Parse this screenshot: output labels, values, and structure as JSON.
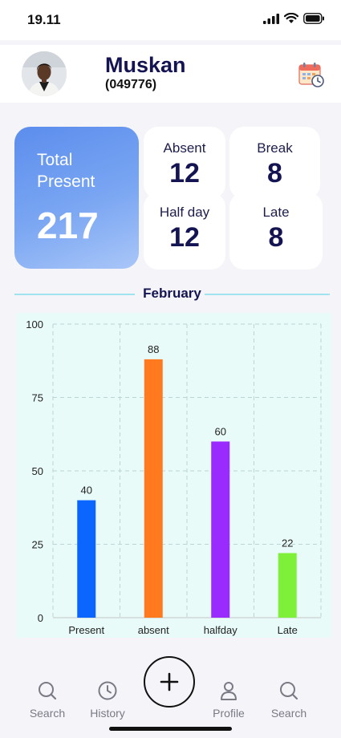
{
  "status_bar": {
    "time": "19.11",
    "icons": [
      "signal-icon",
      "wifi-icon",
      "battery-icon"
    ]
  },
  "header": {
    "name": "Muskan",
    "employee_id": "(049776)",
    "avatar_icon": "user-avatar",
    "calendar_icon": "calendar-clock-icon"
  },
  "stats": {
    "total_present": {
      "label": "Total Present",
      "value": "217"
    },
    "absent": {
      "label": "Absent",
      "value": "12"
    },
    "break": {
      "label": "Break",
      "value": "8"
    },
    "half_day": {
      "label": "Half day",
      "value": "12"
    },
    "late": {
      "label": "Late",
      "value": "8"
    }
  },
  "month": "February",
  "colors": {
    "accent": "#5b8ded",
    "chart_bg": "#e8fbf8",
    "present": "#0b66ff",
    "absent": "#ff7a1f",
    "halfday": "#9a2bff",
    "late": "#7ff03a"
  },
  "chart_data": {
    "type": "bar",
    "categories": [
      "Present",
      "absent",
      "halfday",
      "Late"
    ],
    "values": [
      40,
      88,
      60,
      22
    ],
    "ylim": [
      0,
      100
    ],
    "yticks": [
      0,
      25,
      50,
      75,
      100
    ],
    "grid": true,
    "bar_colors": [
      "#0b66ff",
      "#ff7a1f",
      "#9a2bff",
      "#7ff03a"
    ],
    "data_labels": true
  },
  "nav": {
    "items": [
      {
        "label": "Search",
        "icon": "search-icon"
      },
      {
        "label": "History",
        "icon": "clock-icon"
      },
      {
        "label": "Profile",
        "icon": "user-icon"
      },
      {
        "label": "Search",
        "icon": "search-icon"
      }
    ],
    "fab_icon": "plus-icon"
  }
}
